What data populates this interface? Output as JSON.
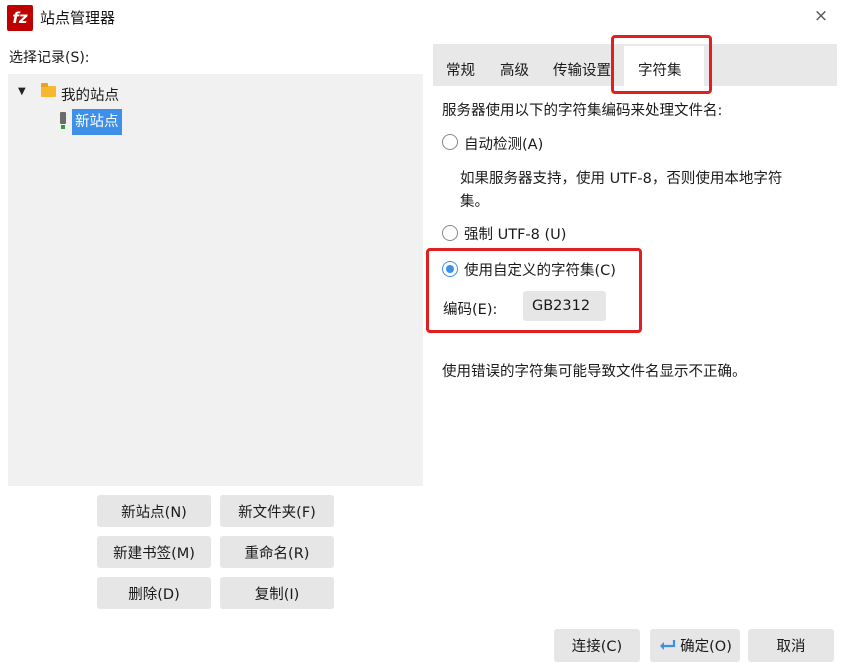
{
  "window": {
    "app_icon_text": "fz",
    "title": "站点管理器",
    "close_glyph": "×"
  },
  "left": {
    "select_label": "选择记录(S):",
    "tree": {
      "folder": "我的站点",
      "items": [
        "新站点"
      ]
    },
    "buttons": {
      "new_site": "新站点(N)",
      "new_folder": "新文件夹(F)",
      "new_bookmark": "新建书签(M)",
      "rename": "重命名(R)",
      "delete": "删除(D)",
      "copy": "复制(I)"
    }
  },
  "tabs": [
    "常规",
    "高级",
    "传输设置",
    "字符集"
  ],
  "active_tab": "字符集",
  "charset": {
    "intro": "服务器使用以下的字符集编码来处理文件名:",
    "auto_detect": "自动检测(A)",
    "auto_detect_desc_line1": "如果服务器支持，使用 UTF-8，否则使用本地字符",
    "auto_detect_desc_line2": "集。",
    "force_utf8": "强制 UTF-8 (U)",
    "custom": "使用自定义的字符集(C)",
    "encoding_label": "编码(E):",
    "encoding_value": "GB2312",
    "warning": "使用错误的字符集可能导致文件名显示不正确。",
    "selected_option": "custom"
  },
  "footer": {
    "connect": "连接(C)",
    "ok": "确定(O)",
    "cancel": "取消"
  },
  "colors": {
    "accent": "#3d8fe8",
    "highlight_box": "#e02020",
    "app_icon": "#bf0000"
  }
}
